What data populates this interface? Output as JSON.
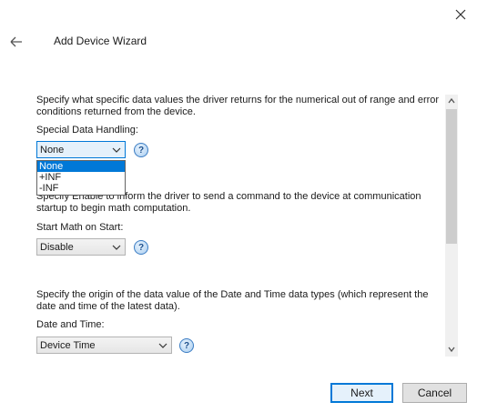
{
  "window": {
    "title": "Add Device Wizard"
  },
  "special": {
    "description": "Specify what specific data values the driver returns for the numerical out of range and error conditions returned from the device.",
    "label": "Special Data Handling:",
    "value": "None",
    "options": [
      "None",
      "+INF",
      "-INF"
    ]
  },
  "math": {
    "description": "Specify Enable to inform the driver to send a command to the device at communication startup to begin math computation.",
    "label": "Start Math on Start:",
    "value": "Disable"
  },
  "datetime": {
    "description": "Specify the origin of the data value of the Date and Time data types (which represent the date and time of the latest data).",
    "label": "Date and Time:",
    "value": "Device Time"
  },
  "footer": {
    "next": "Next",
    "cancel": "Cancel"
  },
  "help_glyph": "?",
  "icons": {
    "close": "close-icon",
    "back": "arrow-left-icon",
    "chevron": "chevron-down-icon",
    "help": "help-icon"
  },
  "colors": {
    "accent": "#0078d7",
    "selection": "#0078d7"
  }
}
